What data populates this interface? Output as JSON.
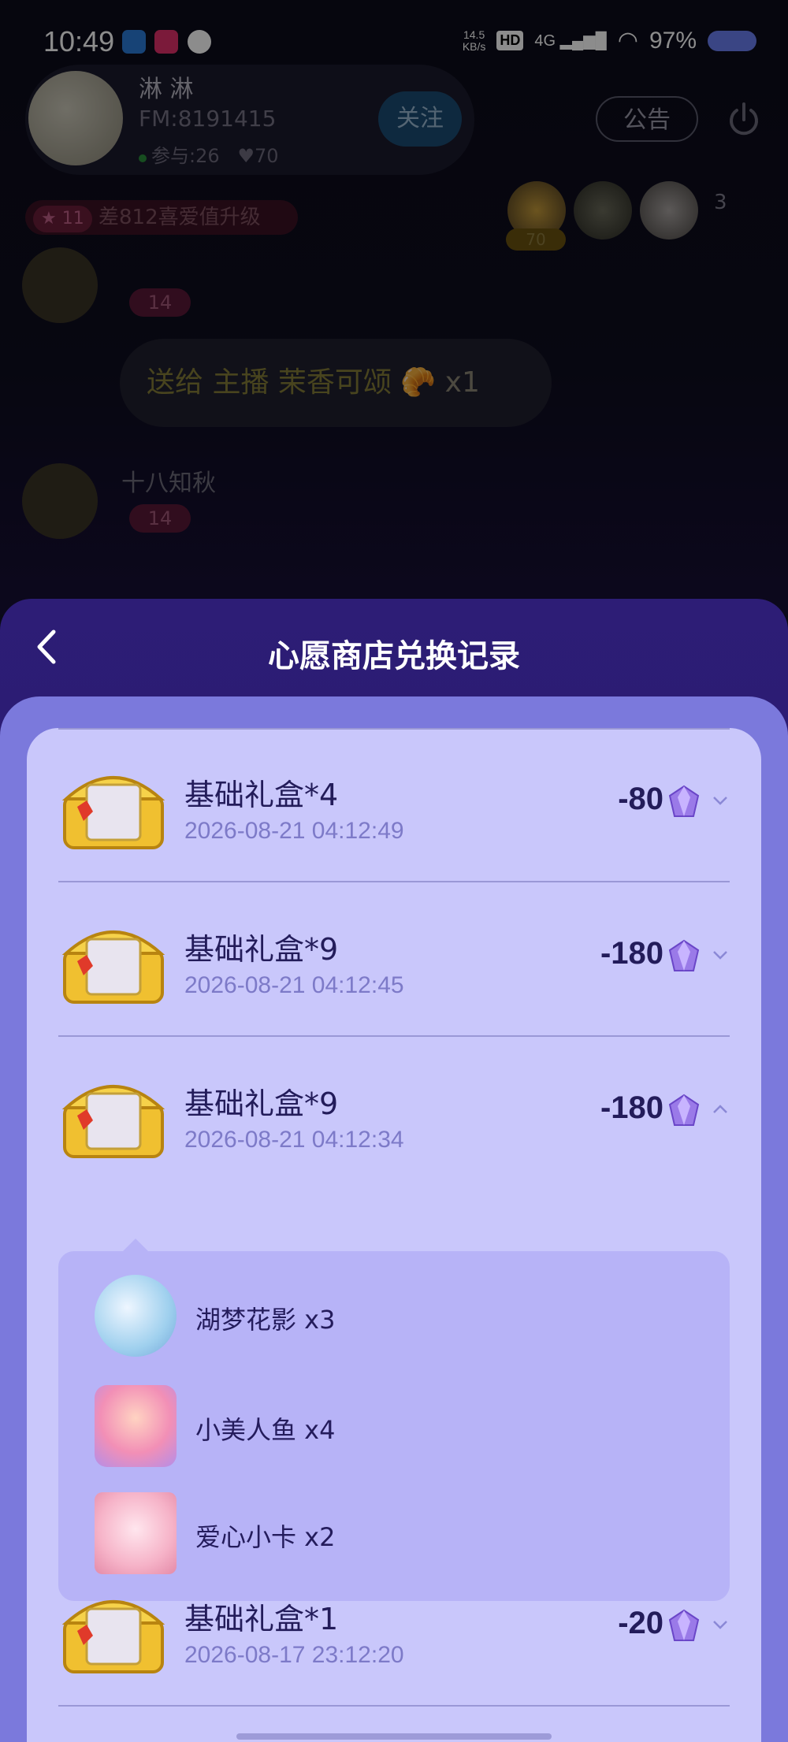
{
  "status_bar": {
    "time": "10:49",
    "net_speed_value": "14.5",
    "net_speed_unit": "KB/s",
    "hd_label": "HD",
    "network": "4G",
    "battery": "97%"
  },
  "room": {
    "host_name": "淋 淋",
    "host_fm": "FM:8191415",
    "participants": "参与:26",
    "likes": "♥70",
    "follow_label": "关注",
    "notice_label": "公告",
    "level_badge": "11",
    "level_text": "差812喜爱值升级",
    "top_viewer_score": "70",
    "viewer_count": "3",
    "messages": [
      {
        "level": "14"
      },
      {
        "gift_text_prefix": "送给 主播",
        "gift_target": "茉香可颂",
        "gift_qty": "x1"
      },
      {
        "user": "十八知秋",
        "level": "14"
      }
    ]
  },
  "sheet": {
    "title": "心愿商店兑换记录",
    "records": [
      {
        "title": "基础礼盒*4",
        "date": "2026-08-21 04:12:49",
        "amount": "-80",
        "expanded": false
      },
      {
        "title": "基础礼盒*9",
        "date": "2026-08-21 04:12:45",
        "amount": "-180",
        "expanded": false
      },
      {
        "title": "基础礼盒*9",
        "date": "2026-08-21 04:12:34",
        "amount": "-180",
        "expanded": true
      },
      {
        "title": "基础礼盒*1",
        "date": "2026-08-17 23:12:20",
        "amount": "-20",
        "expanded": false
      }
    ],
    "detail_items": [
      {
        "name": "湖梦花影 x3"
      },
      {
        "name": "小美人鱼 x4"
      },
      {
        "name": "爱心小卡 x2"
      }
    ]
  },
  "colors": {
    "sheet_bg": "#2d1d76",
    "panel_bg": "#7b79dc",
    "card_bg": "#c9c7fb",
    "detail_bg": "#b7b3f7",
    "text_dark": "#231c5a",
    "text_date": "#7d7ac8"
  }
}
